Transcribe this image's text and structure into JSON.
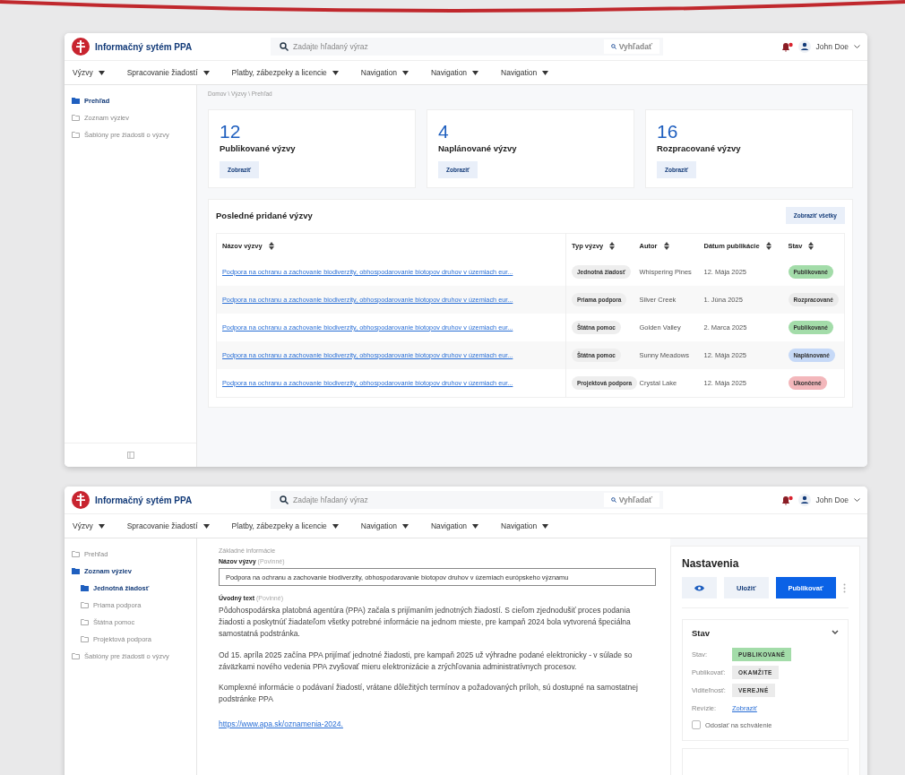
{
  "dashboard_window": {
    "header": {
      "app_title": "Informačný sytém PPA",
      "search_placeholder": "Zadajte hľadaný výraz",
      "search_button": "Vyhľadať",
      "user_name": "John Doe"
    },
    "nav": [
      "Výzvy",
      "Spracovanie žiadostí",
      "Platby, zábezpeky a licencie",
      "Navigation",
      "Navigation",
      "Navigation"
    ],
    "sidebar": [
      {
        "label": "Prehľad",
        "selected": true
      },
      {
        "label": "Zoznam výziev",
        "selected": false
      },
      {
        "label": "Šablóny pre žiadosti o výzvy",
        "selected": false
      }
    ],
    "breadcrumb": "Domov \\ Výzvy \\ Prehľad",
    "stat_cards": [
      {
        "value": "12",
        "label": "Publikované výzvy",
        "button": "Zobraziť"
      },
      {
        "value": "4",
        "label": "Naplánované výzvy",
        "button": "Zobraziť"
      },
      {
        "value": "16",
        "label": "Rozpracované výzvy",
        "button": "Zobraziť"
      }
    ],
    "recent": {
      "title": "Posledné pridané výzvy",
      "button": "Zobraziť všetky",
      "columns": [
        "Názov výzvy",
        "Typ výzvy",
        "Autor",
        "Dátum publikácie",
        "Stav"
      ],
      "rows": [
        {
          "name": "Podpora na ochranu a zachovanie biodiverzity, obhospodarovanie biotopov druhov v územiach eur...",
          "type": "Jednotná žiadosť",
          "author": "Whispering Pines",
          "date": "12. Mája 2025",
          "status": {
            "label": "Publikované",
            "color": "#a3dca9"
          }
        },
        {
          "name": "Podpora na ochranu a zachovanie biodiverzity, obhospodarovanie biotopov druhov v územiach eur...",
          "type": "Priama podpora",
          "author": "Silver Creek",
          "date": "1. Júna 2025",
          "status": {
            "label": "Rozpracované",
            "color": "#ebebeb"
          }
        },
        {
          "name": "Podpora na ochranu a zachovanie biodiverzity, obhospodarovanie biotopov druhov v územiach eur...",
          "type": "Štátna pomoc",
          "author": "Golden Valley",
          "date": "2. Marca 2025",
          "status": {
            "label": "Publikované",
            "color": "#a3dca9"
          }
        },
        {
          "name": "Podpora na ochranu a zachovanie biodiverzity, obhospodarovanie biotopov druhov v územiach eur...",
          "type": "Štátna pomoc",
          "author": "Sunny Meadows",
          "date": "12. Mája 2025",
          "status": {
            "label": "Naplánované",
            "color": "#c6d9f7"
          }
        },
        {
          "name": "Podpora na ochranu a zachovanie biodiverzity, obhospodarovanie biotopov druhov v územiach eur...",
          "type": "Projektová podpora",
          "author": "Crystal Lake",
          "date": "12. Mája 2025",
          "status": {
            "label": "Ukončené",
            "color": "#f3b7bb"
          }
        }
      ]
    }
  },
  "editor_window": {
    "header": {
      "app_title": "Informačný sytém PPA",
      "search_placeholder": "Zadajte hľadaný výraz",
      "search_button": "Vyhľadať",
      "user_name": "John Doe"
    },
    "nav": [
      "Výzvy",
      "Spracovanie žiadostí",
      "Platby, zábezpeky a licencie",
      "Navigation",
      "Navigation",
      "Navigation"
    ],
    "sidebar": [
      {
        "label": "Prehľad",
        "selected": false
      },
      {
        "label": "Zoznam výziev",
        "selected": true,
        "children": [
          {
            "label": "Jednotná žiadosť",
            "selected": true
          },
          {
            "label": "Priama podpora",
            "selected": false
          },
          {
            "label": "Štátna pomoc",
            "selected": false
          },
          {
            "label": "Projektová podpora",
            "selected": false
          }
        ]
      },
      {
        "label": "Šablóny pre žiadosti o výzvy",
        "selected": false
      }
    ],
    "form": {
      "section_label": "Základné informácie",
      "name_label": "Názov výzvy",
      "name_hint": "(Povinné)",
      "name_value": "Podpora na ochranu a zachovanie biodiverzity, obhospodarovanie biotopov druhov v územiach európskeho významu",
      "intro_label": "Úvodný text",
      "intro_hint": "(Povinné)",
      "paragraphs": [
        "Pôdohospodárska platobná agentúra (PPA) začala s prijímaním jednotných žiadostí. S cieľom zjednodušiť proces podania žiadosti a poskytnúť žiadateľom všetky potrebné informácie na jednom mieste, pre kampaň 2024 bola vytvorená špeciálna samostatná podstránka.",
        "Od 15. apríla 2025 začína PPA prijímať jednotné žiadosti, pre kampaň 2025 už výhradne podané elektronicky - v súlade so záväzkami nového vedenia PPA zvyšovať mieru elektronizácie a zrýchľovania administratívnych procesov.",
        "Komplexné informácie o podávaní žiadostí, vrátane dôležitých termínov a požadovaných príloh, sú dostupné na samostatnej podstránke PPA"
      ],
      "link": "https://www.apa.sk/oznamenia-2024."
    },
    "settings": {
      "title": "Nastavenia",
      "save_button": "Uložiť",
      "publish_button": "Publikovať",
      "section": {
        "title": "Stav",
        "expanded": true,
        "rows": [
          {
            "label": "Stav:",
            "kind": "tag",
            "value": "PUBLIKOVANÉ",
            "color": "#a3dca9"
          },
          {
            "label": "Publikovať:",
            "kind": "tag",
            "value": "OKAMŽITE",
            "color": "#ebebeb"
          },
          {
            "label": "Viditeľnosť:",
            "kind": "tag",
            "value": "VEREJNÉ",
            "color": "#ebebeb"
          },
          {
            "label": "Revízie:",
            "kind": "link",
            "value": "Zobraziť"
          }
        ],
        "checkbox": {
          "label": "Odoslať na schválenie",
          "checked": false
        }
      }
    }
  }
}
